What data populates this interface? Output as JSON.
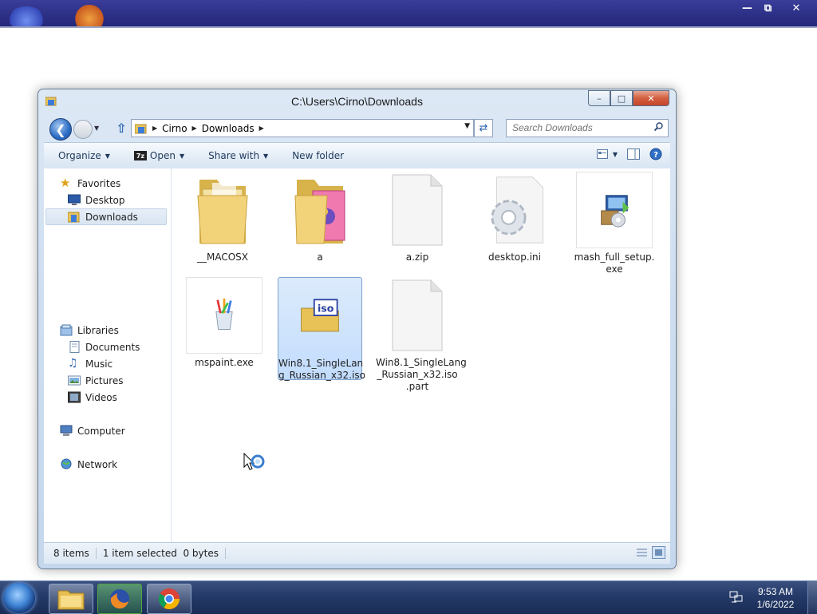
{
  "outer_window": {
    "minimize": "—",
    "restore": "⧉",
    "close": "✕"
  },
  "window": {
    "title": "C:\\Users\\Cirno\\Downloads",
    "minimize": "–",
    "maximize": "□",
    "close": "✕"
  },
  "address": {
    "crumbs": [
      "Cirno",
      "Downloads"
    ]
  },
  "search": {
    "placeholder": "Search Downloads"
  },
  "toolbar": {
    "organize": "Organize",
    "open": "Open",
    "open_badge": "7z",
    "share_with": "Share with",
    "new_folder": "New folder"
  },
  "nav": {
    "favorites": "Favorites",
    "desktop": "Desktop",
    "downloads": "Downloads",
    "libraries": "Libraries",
    "documents": "Documents",
    "music": "Music",
    "pictures": "Pictures",
    "videos": "Videos",
    "computer": "Computer",
    "network": "Network"
  },
  "files": [
    {
      "name": "__MACOSX",
      "type": "folder"
    },
    {
      "name": "a",
      "type": "folder-pictures"
    },
    {
      "name": "a.zip",
      "type": "blank"
    },
    {
      "name": "desktop.ini",
      "type": "settings"
    },
    {
      "name": "mash_full_setup.\nexe",
      "type": "installer"
    },
    {
      "name": "mspaint.exe",
      "type": "paint"
    },
    {
      "name": "Win8.1_SingleLan\ng_Russian_x32.iso",
      "type": "iso",
      "selected": true
    },
    {
      "name": "Win8.1_SingleLang\n_Russian_x32.iso\n.part",
      "type": "blank"
    }
  ],
  "status": {
    "items": "8 items",
    "selected": "1 item selected",
    "size": "0 bytes"
  },
  "taskbar": {
    "time": "9:53 AM",
    "date": "1/6/2022",
    "apps": [
      "file-explorer",
      "firefox",
      "chrome"
    ]
  },
  "colors": {
    "accent": "#3399ff",
    "selection": "#c2dcfd",
    "taskbar": "#243a68"
  }
}
